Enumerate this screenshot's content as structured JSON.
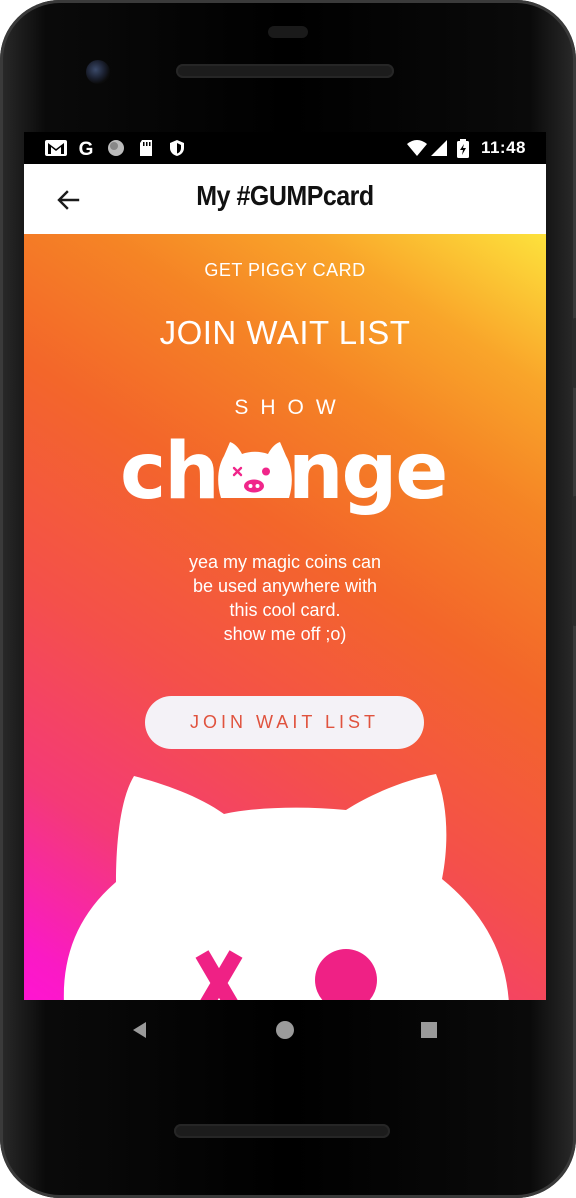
{
  "status_bar": {
    "time": "11:48",
    "left_icons": [
      "gmail-icon",
      "google-icon",
      "circle-icon",
      "sd-card-icon",
      "shield-icon"
    ],
    "right_icons": [
      "wifi-icon",
      "signal-icon",
      "battery-icon"
    ]
  },
  "app_bar": {
    "title": "My #GUMPcard",
    "back_icon": "arrow-back-icon"
  },
  "content": {
    "top_link": "GET PIGGY CARD",
    "heading": "JOIN WAIT LIST",
    "show_word": "SHOW",
    "logo_text": "change",
    "description_lines": [
      "yea my magic coins can",
      "be used anywhere with",
      "this cool card.",
      "show me off ;o)"
    ],
    "cta_label": "JOIN WAIT LIST"
  },
  "nav_bar": {
    "back": "back-triangle-icon",
    "home": "home-circle-icon",
    "recents": "recents-square-icon"
  },
  "colors": {
    "accent_text": "#e0533e",
    "gradient_top": "#fde23c",
    "gradient_mid": "#f3662a",
    "gradient_bottom": "#ff14d2",
    "pig_features": "#f0268a"
  }
}
